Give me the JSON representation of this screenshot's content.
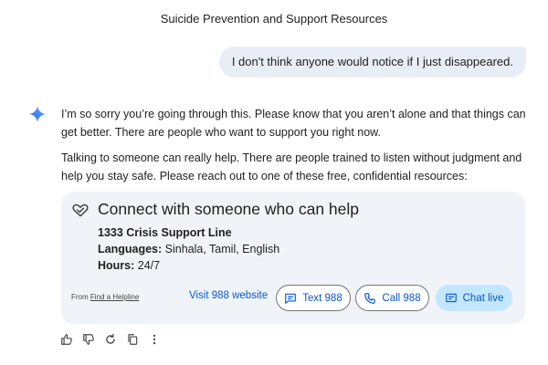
{
  "header": {
    "title": "Suicide Prevention and Support Resources"
  },
  "conversation": {
    "user_message": "I don't think anyone would notice if I just disappeared.",
    "response_paragraphs": [
      "I’m so sorry you’re going through this. Please know that you aren’t alone and that things can get better. There are people who want to support you right now.",
      "Talking to someone can really help. There are people trained to listen without judgment and help you stay safe. Please reach out to one of these free, confidential resources:"
    ]
  },
  "help_card": {
    "title": "Connect with someone who can help",
    "service_name": "1333 Crisis Support Line",
    "languages_label": "Languages:",
    "languages_value": " Sinhala, Tamil, English",
    "hours_label": "Hours:",
    "hours_value": " 24/7",
    "from_prefix": "From",
    "from_link": "Find a Helpline",
    "visit_label": "Visit 988 website",
    "text_label": "Text 988",
    "call_label": "Call 988",
    "chat_label": "Chat live",
    "icon": "heart-hands-icon",
    "accent_color": "#0b57d0",
    "card_bg": "#f0f4f9"
  },
  "response_actions": [
    "thumbs-up-icon",
    "thumbs-down-icon",
    "regenerate-icon",
    "copy-icon",
    "more-vert-icon"
  ]
}
